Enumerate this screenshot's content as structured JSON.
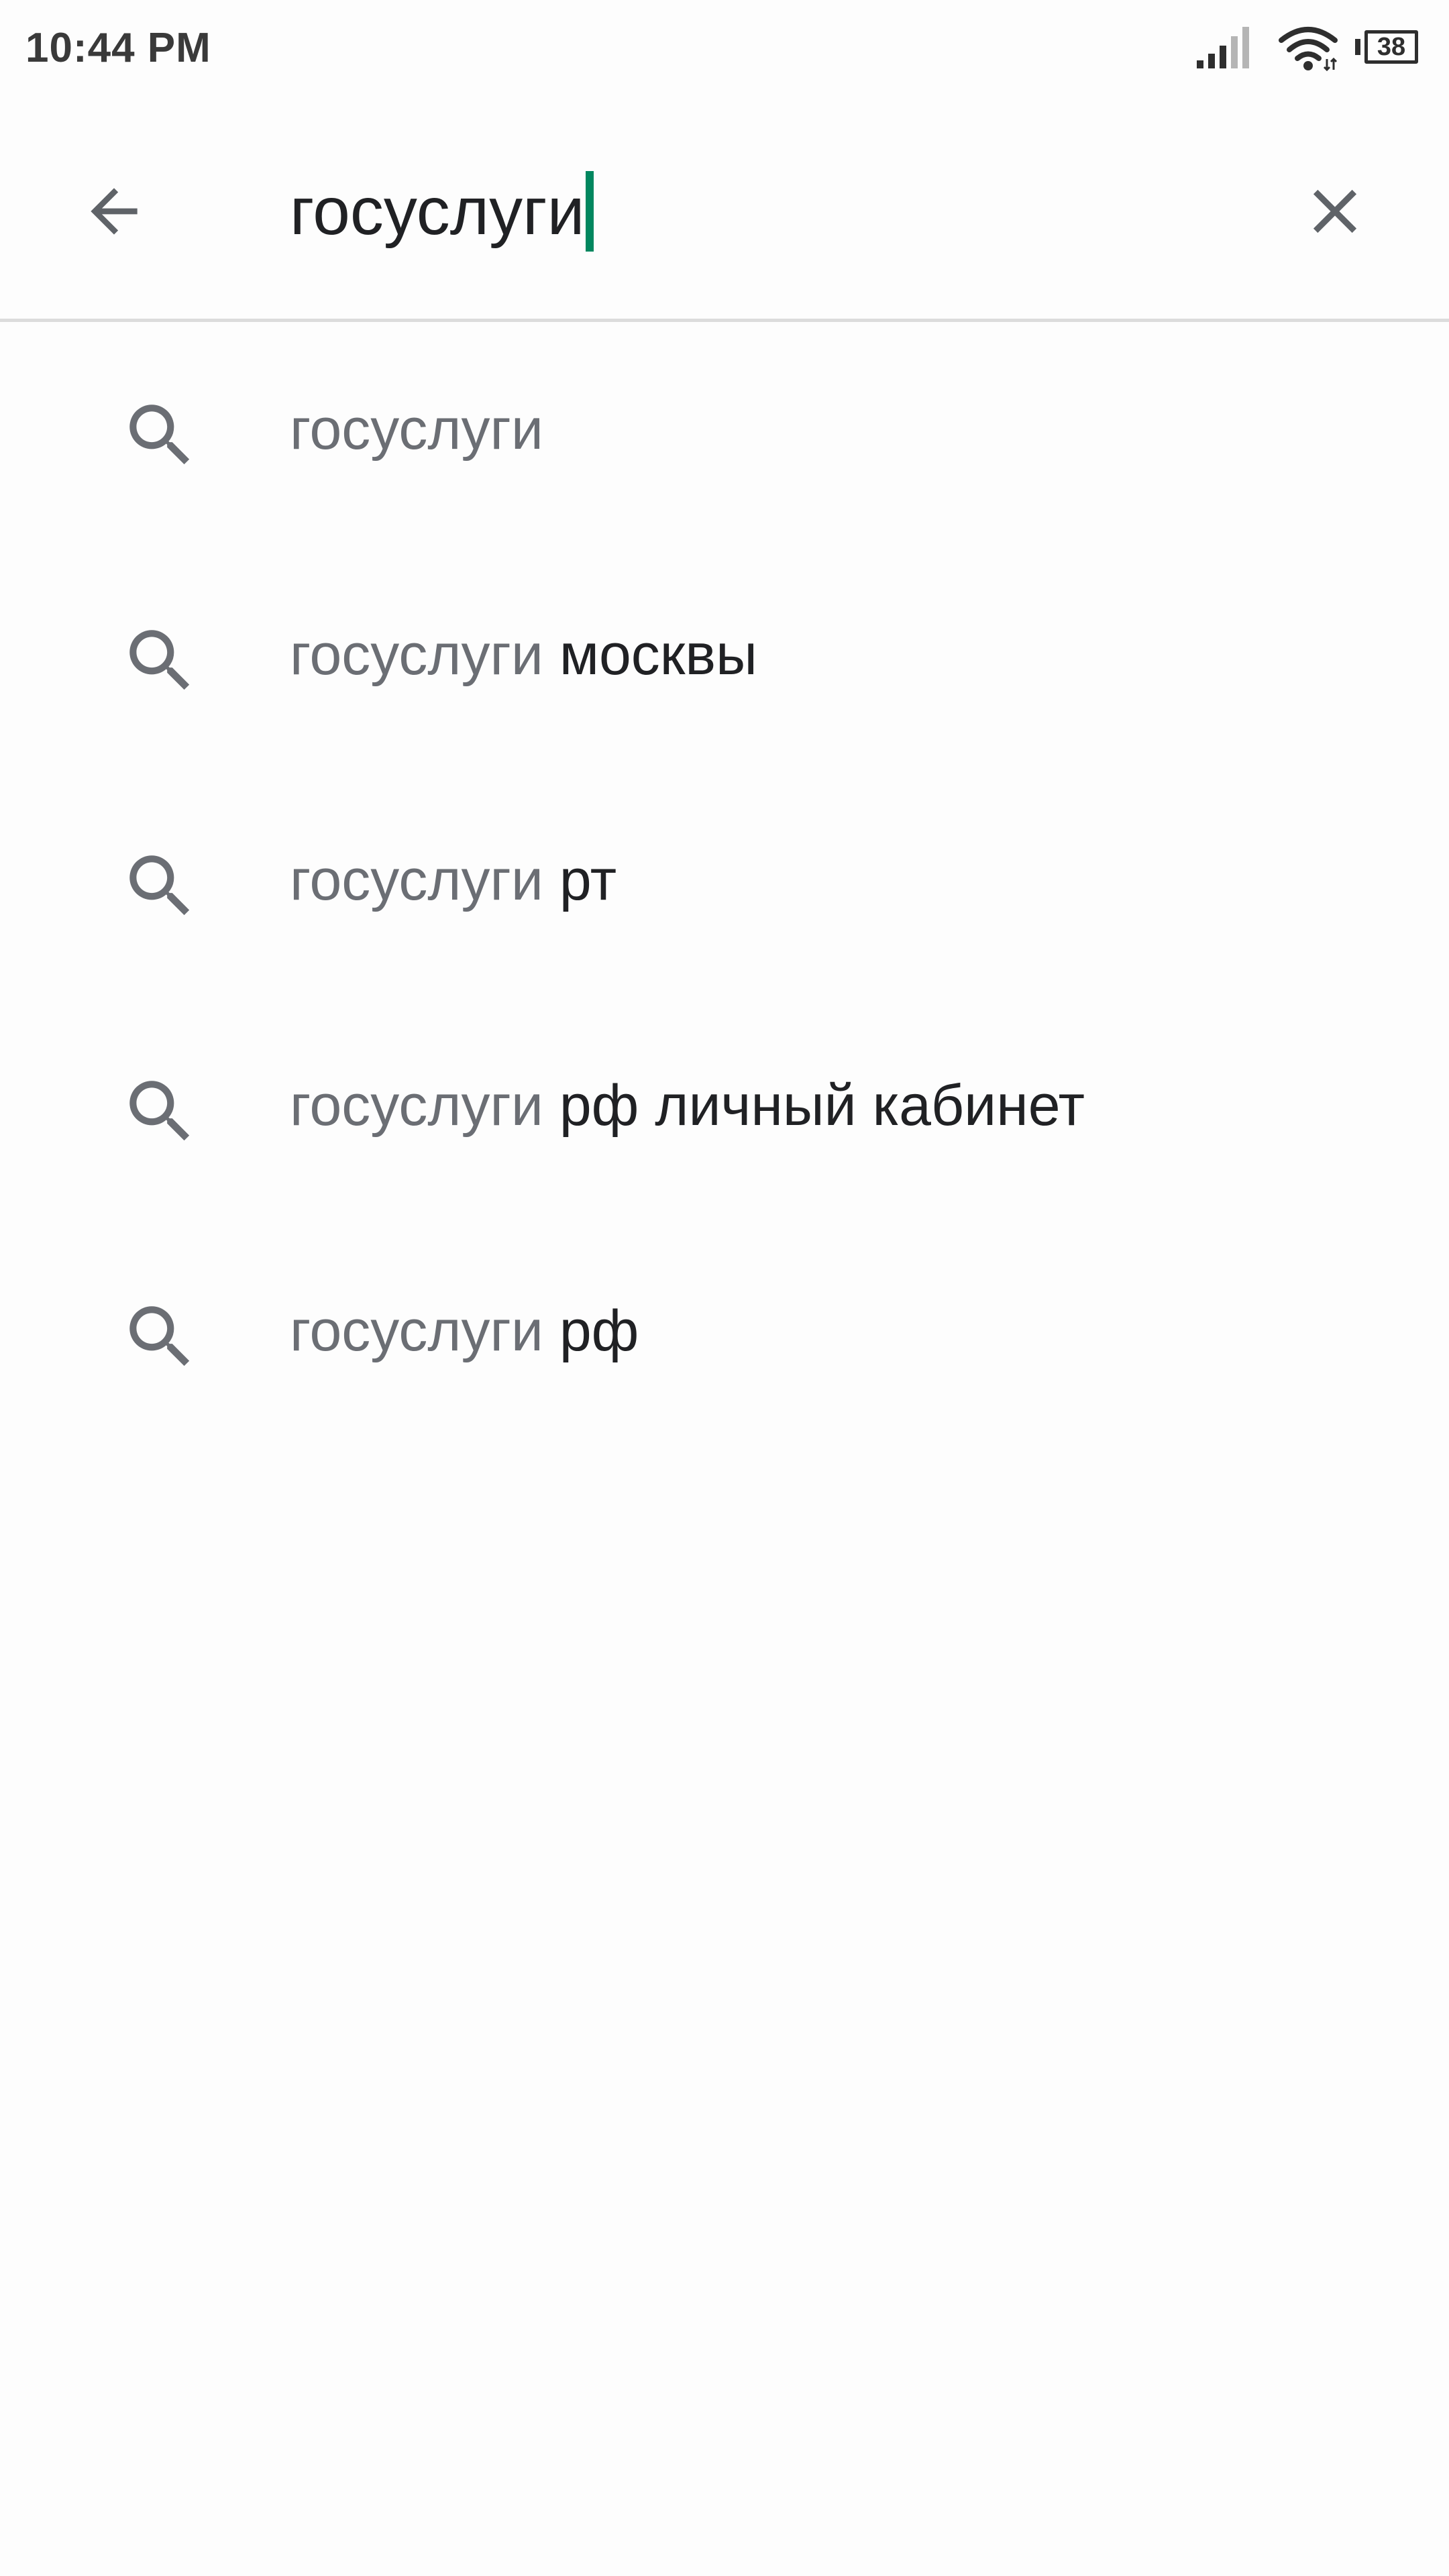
{
  "status_bar": {
    "time": "10:44 PM",
    "battery_level": "38",
    "icons": [
      "signal-icon",
      "wifi-icon",
      "battery-icon"
    ]
  },
  "search": {
    "query": "госуслуги",
    "back_icon": "arrow-back-icon",
    "clear_icon": "close-icon",
    "cursor_color": "#01875f"
  },
  "suggestions": [
    {
      "match": "госуслуги",
      "rest": ""
    },
    {
      "match": "госуслуги",
      "rest": " москвы"
    },
    {
      "match": "госуслуги",
      "rest": " рт"
    },
    {
      "match": "госуслуги",
      "rest": " рф личный кабинет"
    },
    {
      "match": "госуслуги",
      "rest": " рф"
    }
  ],
  "colors": {
    "match_text": "#6b6e74",
    "rest_text": "#202124",
    "icon": "#6b6e74",
    "divider": "#dcdcdc"
  }
}
